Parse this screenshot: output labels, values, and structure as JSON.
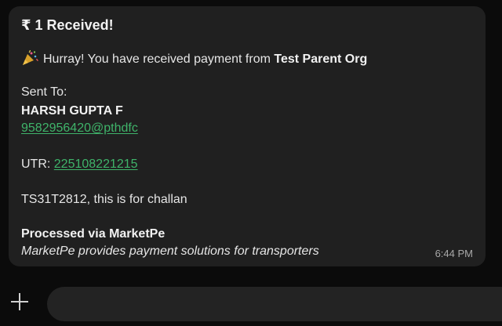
{
  "message": {
    "title": "₹ 1 Received!",
    "hurray_text": "Hurray! You have received payment from ",
    "payer_name": "Test Parent Org",
    "sent_to_label": "Sent To:",
    "recipient_name": "HARSH GUPTA F",
    "recipient_upi": "9582956420@pthdfc",
    "utr_label": "UTR: ",
    "utr_value": "225108221215",
    "note": "TS31T2812, this is for challan",
    "processed_label": "Processed via MarketPe",
    "tagline": "MarketPe provides payment solutions for transporters",
    "time": "6:44 PM",
    "icon": "party-popper-icon"
  },
  "composer": {
    "add_icon": "plus-icon",
    "input_value": "",
    "input_placeholder": ""
  },
  "colors": {
    "background": "#0b0b0b",
    "bubble": "#202020",
    "link": "#3fb46a",
    "text": "#e6e6e6",
    "time": "#a8a8a8"
  }
}
